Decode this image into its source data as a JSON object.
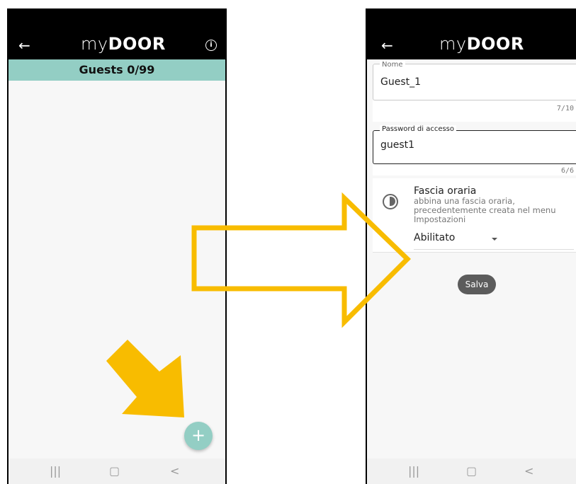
{
  "left_screen": {
    "logo": {
      "my": "my",
      "door": "DOOR"
    },
    "back_icon": "arrow-left",
    "info_icon": "info-circle",
    "info_glyph": "i",
    "guests_header": "Guests 0/99",
    "fab_label": "+"
  },
  "right_screen": {
    "logo": {
      "my": "my",
      "door": "DOOR"
    },
    "back_icon": "arrow-left",
    "name_field": {
      "label": "Nome",
      "value": "Guest_1",
      "counter": "7/10"
    },
    "password_field": {
      "label": "Password di accesso",
      "value": "guest1",
      "counter": "6/6"
    },
    "time_slot": {
      "title": "Fascia oraria",
      "description": "abbina una fascia oraria, precedentemente creata nel menu Impostazioni",
      "selected": "Abilitato"
    },
    "save_label": "Salva"
  },
  "nav": {
    "recent": "|||",
    "home": "▢",
    "back": "<"
  },
  "colors": {
    "accent": "#93cec4",
    "annotation": "#f8bc00",
    "appbar": "#000000",
    "save_button": "#5c5c5c"
  }
}
